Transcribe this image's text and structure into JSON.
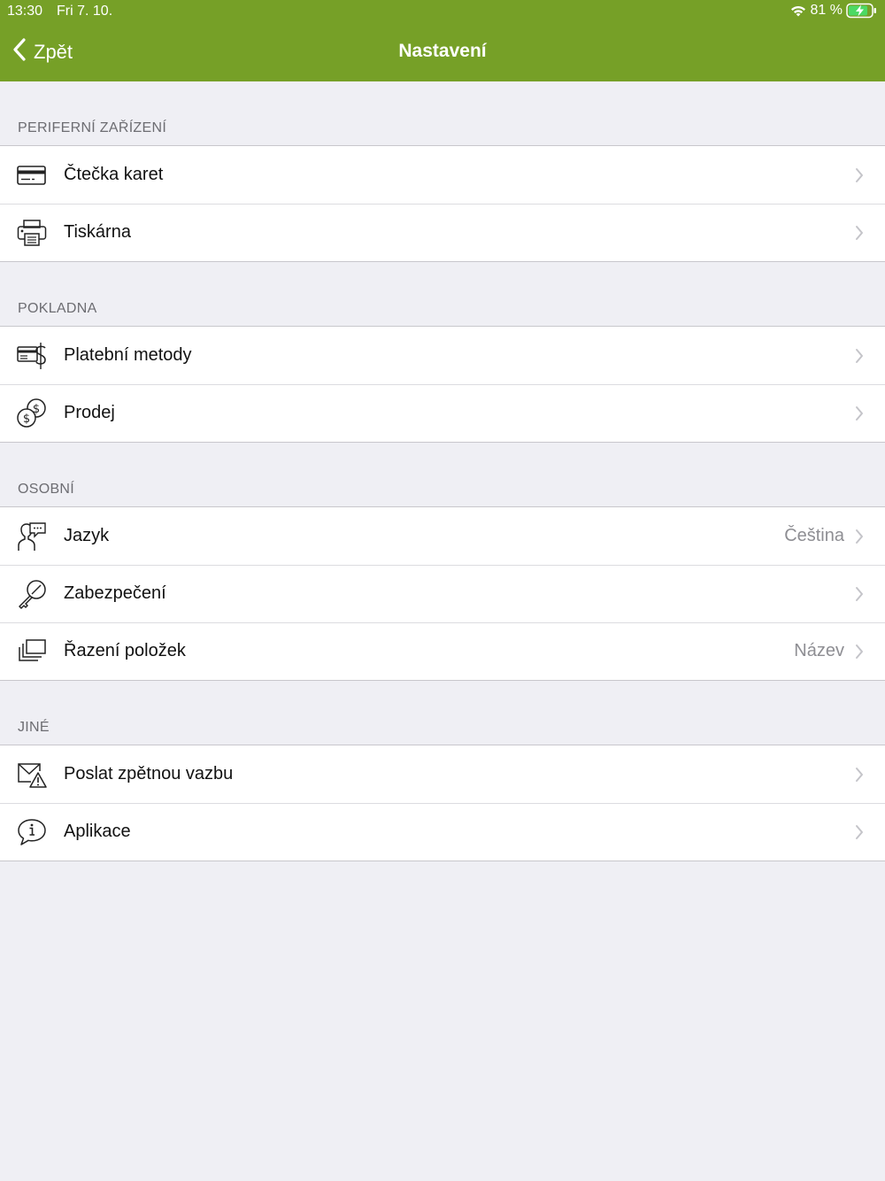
{
  "status": {
    "time": "13:30",
    "date": "Fri 7. 10.",
    "battery": "81 %"
  },
  "nav": {
    "back_label": "Zpět",
    "title": "Nastavení"
  },
  "colors": {
    "accent": "#76a027",
    "background": "#efeff4"
  },
  "sections": [
    {
      "header": "PERIFERNÍ ZAŘÍZENÍ",
      "items": [
        {
          "icon": "credit-card-icon",
          "label": "Čtečka karet"
        },
        {
          "icon": "printer-icon",
          "label": "Tiskárna"
        }
      ]
    },
    {
      "header": "POKLADNA",
      "items": [
        {
          "icon": "payment-methods-icon",
          "label": "Platební metody"
        },
        {
          "icon": "coins-icon",
          "label": "Prodej"
        }
      ]
    },
    {
      "header": "OSOBNÍ",
      "items": [
        {
          "icon": "language-icon",
          "label": "Jazyk",
          "value": "Čeština"
        },
        {
          "icon": "key-icon",
          "label": "Zabezpečení"
        },
        {
          "icon": "stack-icon",
          "label": "Řazení položek",
          "value": "Název"
        }
      ]
    },
    {
      "header": "JINÉ",
      "items": [
        {
          "icon": "feedback-mail-icon",
          "label": "Poslat zpětnou vazbu"
        },
        {
          "icon": "info-bubble-icon",
          "label": "Aplikace"
        }
      ]
    }
  ]
}
